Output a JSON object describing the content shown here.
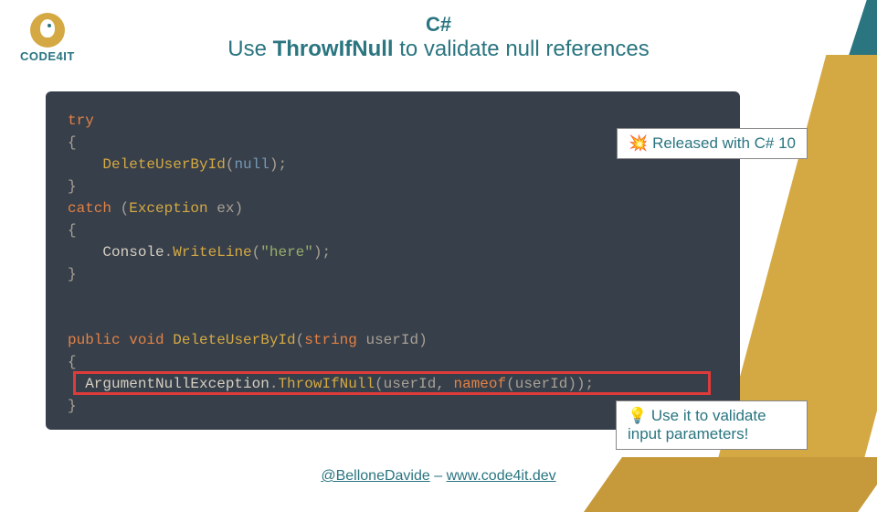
{
  "logo": {
    "text": "CODE4IT"
  },
  "title": {
    "line1": "C#",
    "line2_pre": "Use ",
    "line2_bold": "ThrowIfNull",
    "line2_post": " to validate null references"
  },
  "code": {
    "l1_try": "try",
    "l2_brace": "{",
    "l3_indent": "    ",
    "l3_func": "DeleteUserById",
    "l3_paren_open": "(",
    "l3_null": "null",
    "l3_paren_close": ");",
    "l4_brace": "}",
    "l5_catch": "catch",
    "l5_space": " (",
    "l5_type": "Exception",
    "l5_var": " ex)",
    "l6_brace": "{",
    "l7_indent": "    ",
    "l7_console": "Console",
    "l7_dot": ".",
    "l7_write": "WriteLine",
    "l7_paren_open": "(",
    "l7_str": "\"here\"",
    "l7_paren_close": ");",
    "l8_brace": "}",
    "l10_public": "public",
    "l10_void": " void",
    "l10_space": " ",
    "l10_func": "DeleteUserById",
    "l10_paren_open": "(",
    "l10_string": "string",
    "l10_param": " userId)",
    "l11_brace": "{",
    "l12_indent": "  ",
    "l12_type": "ArgumentNullException",
    "l12_dot": ".",
    "l12_method": "ThrowIfNull",
    "l12_args": "(userId, ",
    "l12_nameof": "nameof",
    "l12_args2": "(userId));",
    "l13_brace": "}"
  },
  "callouts": {
    "top_icon": "💥",
    "top_text": " Released with C# 10",
    "bottom_icon": "💡",
    "bottom_text": " Use it to validate input parameters!"
  },
  "footer": {
    "handle": "@BelloneDavide",
    "sep": " – ",
    "site": "www.code4it.dev"
  }
}
